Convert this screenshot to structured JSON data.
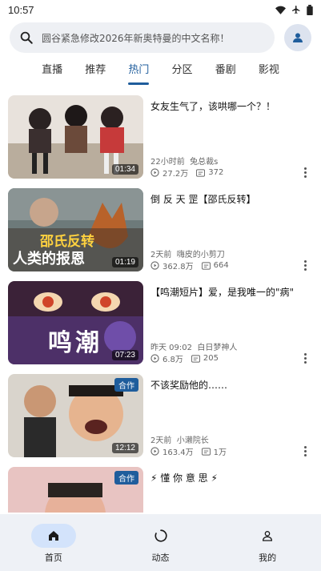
{
  "status": {
    "time": "10:57"
  },
  "search": {
    "placeholder": "圆谷紧急修改2026年新奥特曼的中文名称！"
  },
  "tabs": [
    "直播",
    "推荐",
    "热门",
    "分区",
    "番剧",
    "影视"
  ],
  "active_tab": "热门",
  "videos": [
    {
      "title": "女友生气了，该哄哪一个？！",
      "time": "22小时前",
      "author": "兔总裁s",
      "views": "27.2万",
      "danmaku": "372",
      "duration": "01:34",
      "collab": ""
    },
    {
      "title": "倒 反 天 罡【邵氏反转】",
      "time": "2天前",
      "author": "嗨皮的小剪刀",
      "views": "362.8万",
      "danmaku": "664",
      "duration": "01:19",
      "collab": "",
      "overlay": "邵氏反转",
      "overlay2": "人类的报恩"
    },
    {
      "title": "【鸣潮短片】爱，是我唯一的\"病\"",
      "time": "昨天 09:02",
      "author": "白日梦神人",
      "views": "6.8万",
      "danmaku": "205",
      "duration": "07:23",
      "collab": "",
      "overlay": "鸣潮"
    },
    {
      "title": "不该奖励他的……",
      "time": "2天前",
      "author": "小濑院长",
      "views": "163.4万",
      "danmaku": "1万",
      "duration": "12:12",
      "collab": "合作"
    },
    {
      "title": "⚡ 懂 你 意 思 ⚡",
      "time": "",
      "author": "",
      "views": "",
      "danmaku": "",
      "duration": "",
      "collab": "合作"
    }
  ],
  "bottom_nav": [
    {
      "label": "首页",
      "icon": "home-icon",
      "active": true
    },
    {
      "label": "动态",
      "icon": "circle-icon",
      "active": false
    },
    {
      "label": "我的",
      "icon": "person-icon",
      "active": false
    }
  ],
  "colors": {
    "accent": "#1f5d9c",
    "nav_bg": "#eef1f6",
    "pill": "#d3e3fb"
  }
}
